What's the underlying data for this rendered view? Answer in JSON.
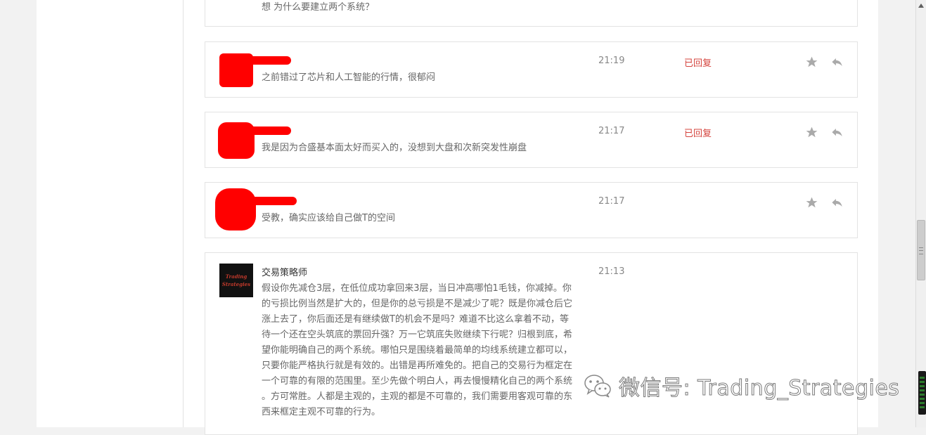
{
  "messages": [
    {
      "text": "想 为什么要建立两个系统？"
    },
    {
      "time": "21:19",
      "status": "已回复",
      "text": "之前错过了芯片和人工智能的行情，很郁闷"
    },
    {
      "time": "21:17",
      "status": "已回复",
      "text": "我是因为合盛基本面太好而买入的，没想到大盘和次新突发性崩盘"
    },
    {
      "time": "21:17",
      "text": "受教，确实应该给自己做T的空间"
    },
    {
      "author": "交易策略师",
      "avatar_text_1": "Trading",
      "avatar_text_2": "Strategies",
      "time": "21:13",
      "lines": [
        "假设你先减仓3层，在低位成功拿回来3层，当日冲高哪怕1毛钱，你减掉。你",
        "的亏损比例当然是扩大的，但是你的总亏损是不是减少了呢？既是你减仓后它",
        "涨上去了，你后面还是有继续做T的机会不是吗？难道不比这么拿着不动，等",
        "待一个还在空头筑底的票回升强？万一它筑底失败继续下行呢？归根到底，希",
        "望你能明确自己的两个系统。哪怕只是围绕着最简单的均线系统建立都可以，",
        "只要你能严格执行就是有效的。出错是再所难免的。把自己的交易行为框定在",
        "一个可靠的有限的范围里。至少先做个明白人，再去慢慢精化自己的两个系统",
        "。方可常胜。人都是主观的，主观的都是不可靠的，我们需要用客观可靠的东",
        "西来框定主观不可靠的行为。"
      ]
    }
  ],
  "watermark": {
    "text": "微信号: Trading_Strategies"
  },
  "colors": {
    "status_replied": "#d5443e",
    "icon_gray": "#aaaaaa",
    "redaction": "#ff0000"
  }
}
